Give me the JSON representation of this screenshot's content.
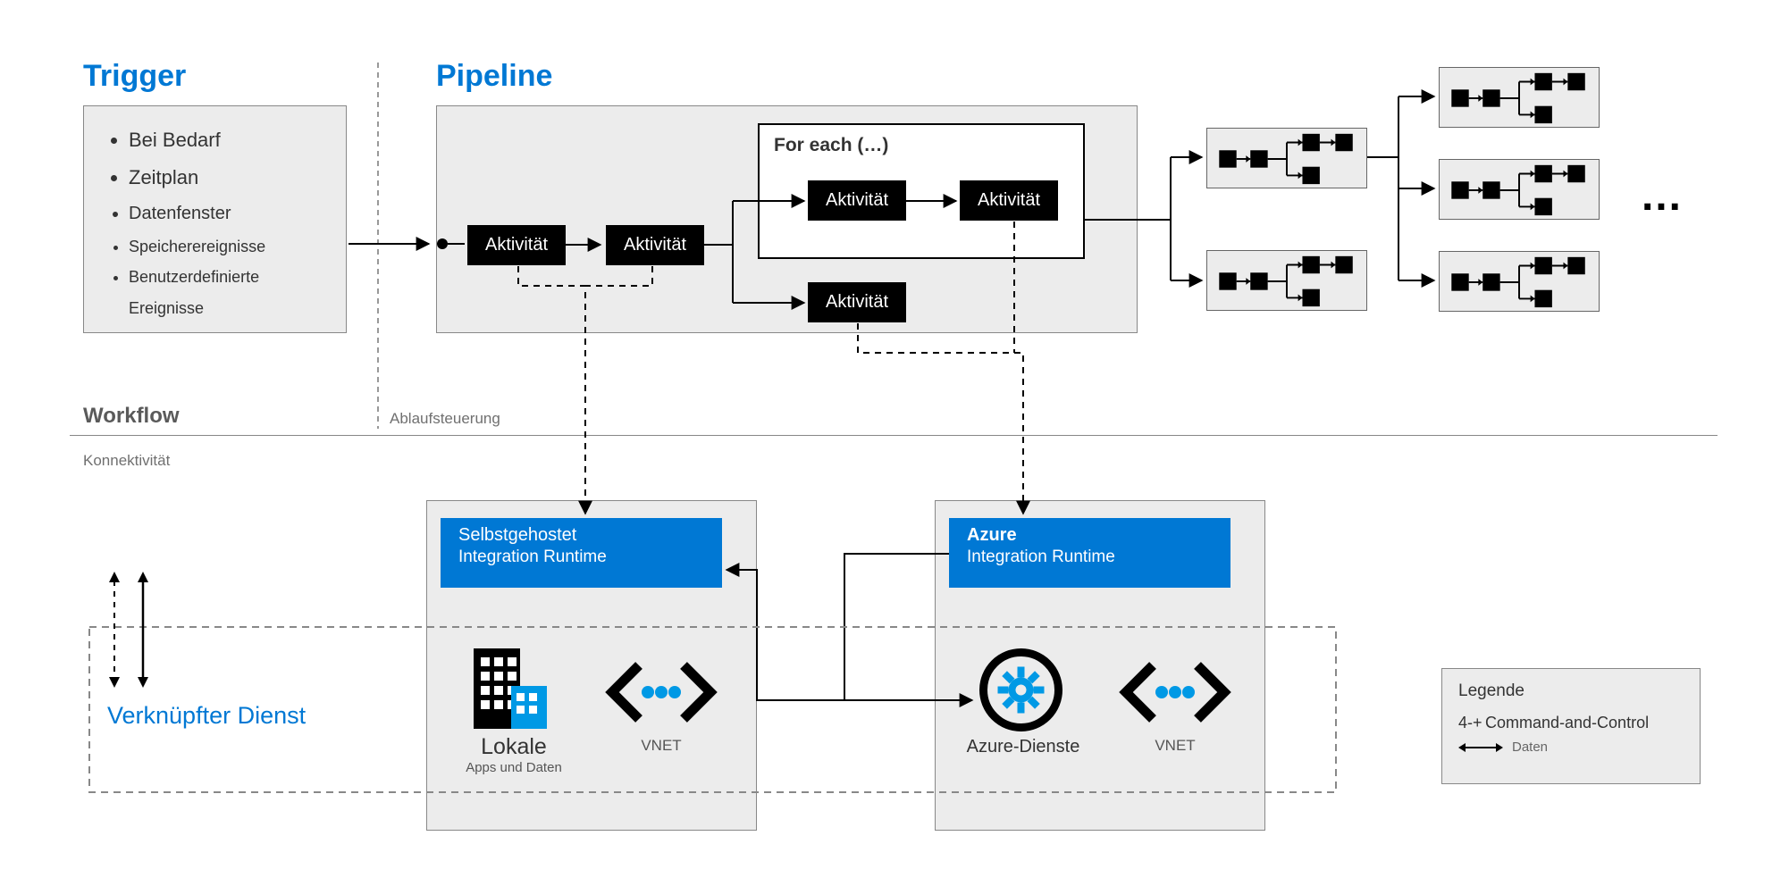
{
  "trigger": {
    "title": "Trigger",
    "items": [
      "Bei Bedarf",
      "Zeitplan",
      "Datenfenster",
      "Speicherereignisse",
      "Benutzerdefinierte Ereignisse"
    ]
  },
  "pipeline": {
    "title": "Pipeline",
    "activity_label": "Aktivität",
    "foreach_label": "For each (…)"
  },
  "sections": {
    "workflow": "Workflow",
    "flow_control": "Ablaufsteuerung",
    "connectivity": "Konnektivität"
  },
  "linked_service": "Verknüpfter Dienst",
  "runtimes": {
    "self": {
      "l1": "Selbstgehostet",
      "l2": "Integration Runtime"
    },
    "azure": {
      "l1": "Azure",
      "l2": "Integration Runtime"
    },
    "local_big": "Lokale",
    "local_small": "Apps und Daten",
    "vnet": "VNET",
    "azure_svc": "Azure-Dienste"
  },
  "legend": {
    "title": "Legende",
    "cc": "Command-and-Control",
    "data": "Daten"
  },
  "ellipsis": "…"
}
